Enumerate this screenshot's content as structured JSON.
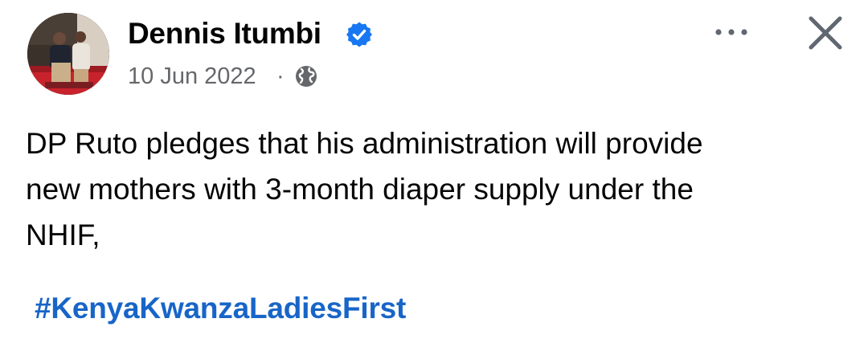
{
  "post": {
    "author": {
      "name": "Dennis Itumbi",
      "verified": true,
      "avatar_icon": "profile-photo"
    },
    "date": "10 Jun 2022",
    "separator": "·",
    "audience_icon": "globe-icon",
    "text_lines": [
      "DP Ruto pledges that his administration will provide",
      "new mothers with 3-month diaper supply under the",
      "NHIF,"
    ],
    "hashtag": "#KenyaKwanzaLadiesFirst"
  },
  "actions": {
    "more_icon": "more-horizontal-icon",
    "close_icon": "close-icon"
  },
  "colors": {
    "verified_badge": "#1877f2",
    "hashtag": "#1865c8",
    "meta_text": "#65676b",
    "body_text": "#050505",
    "icon_gray": "#606770"
  }
}
